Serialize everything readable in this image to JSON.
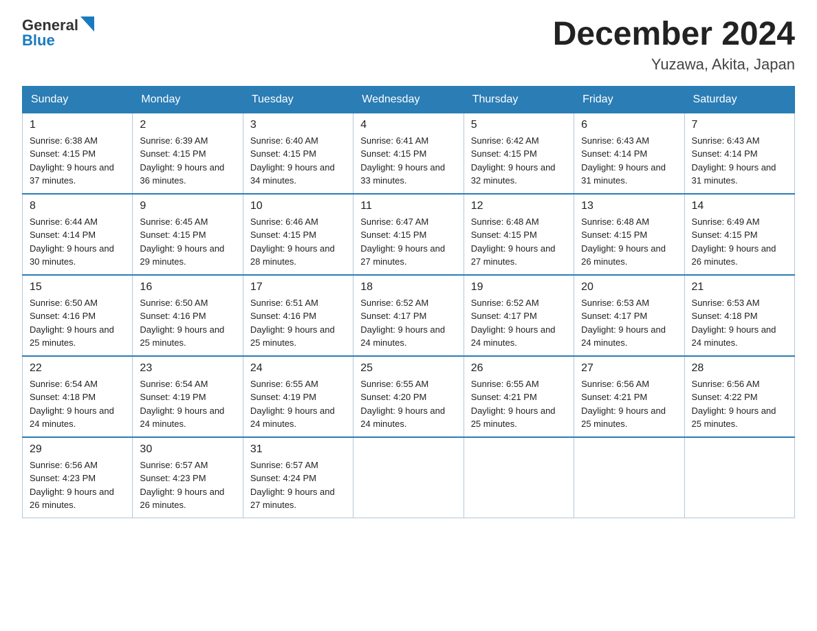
{
  "header": {
    "logo_general": "General",
    "logo_blue": "Blue",
    "month_title": "December 2024",
    "location": "Yuzawa, Akita, Japan"
  },
  "days_of_week": [
    "Sunday",
    "Monday",
    "Tuesday",
    "Wednesday",
    "Thursday",
    "Friday",
    "Saturday"
  ],
  "weeks": [
    [
      {
        "day": "1",
        "sunrise": "6:38 AM",
        "sunset": "4:15 PM",
        "daylight": "9 hours and 37 minutes."
      },
      {
        "day": "2",
        "sunrise": "6:39 AM",
        "sunset": "4:15 PM",
        "daylight": "9 hours and 36 minutes."
      },
      {
        "day": "3",
        "sunrise": "6:40 AM",
        "sunset": "4:15 PM",
        "daylight": "9 hours and 34 minutes."
      },
      {
        "day": "4",
        "sunrise": "6:41 AM",
        "sunset": "4:15 PM",
        "daylight": "9 hours and 33 minutes."
      },
      {
        "day": "5",
        "sunrise": "6:42 AM",
        "sunset": "4:15 PM",
        "daylight": "9 hours and 32 minutes."
      },
      {
        "day": "6",
        "sunrise": "6:43 AM",
        "sunset": "4:14 PM",
        "daylight": "9 hours and 31 minutes."
      },
      {
        "day": "7",
        "sunrise": "6:43 AM",
        "sunset": "4:14 PM",
        "daylight": "9 hours and 31 minutes."
      }
    ],
    [
      {
        "day": "8",
        "sunrise": "6:44 AM",
        "sunset": "4:14 PM",
        "daylight": "9 hours and 30 minutes."
      },
      {
        "day": "9",
        "sunrise": "6:45 AM",
        "sunset": "4:15 PM",
        "daylight": "9 hours and 29 minutes."
      },
      {
        "day": "10",
        "sunrise": "6:46 AM",
        "sunset": "4:15 PM",
        "daylight": "9 hours and 28 minutes."
      },
      {
        "day": "11",
        "sunrise": "6:47 AM",
        "sunset": "4:15 PM",
        "daylight": "9 hours and 27 minutes."
      },
      {
        "day": "12",
        "sunrise": "6:48 AM",
        "sunset": "4:15 PM",
        "daylight": "9 hours and 27 minutes."
      },
      {
        "day": "13",
        "sunrise": "6:48 AM",
        "sunset": "4:15 PM",
        "daylight": "9 hours and 26 minutes."
      },
      {
        "day": "14",
        "sunrise": "6:49 AM",
        "sunset": "4:15 PM",
        "daylight": "9 hours and 26 minutes."
      }
    ],
    [
      {
        "day": "15",
        "sunrise": "6:50 AM",
        "sunset": "4:16 PM",
        "daylight": "9 hours and 25 minutes."
      },
      {
        "day": "16",
        "sunrise": "6:50 AM",
        "sunset": "4:16 PM",
        "daylight": "9 hours and 25 minutes."
      },
      {
        "day": "17",
        "sunrise": "6:51 AM",
        "sunset": "4:16 PM",
        "daylight": "9 hours and 25 minutes."
      },
      {
        "day": "18",
        "sunrise": "6:52 AM",
        "sunset": "4:17 PM",
        "daylight": "9 hours and 24 minutes."
      },
      {
        "day": "19",
        "sunrise": "6:52 AM",
        "sunset": "4:17 PM",
        "daylight": "9 hours and 24 minutes."
      },
      {
        "day": "20",
        "sunrise": "6:53 AM",
        "sunset": "4:17 PM",
        "daylight": "9 hours and 24 minutes."
      },
      {
        "day": "21",
        "sunrise": "6:53 AM",
        "sunset": "4:18 PM",
        "daylight": "9 hours and 24 minutes."
      }
    ],
    [
      {
        "day": "22",
        "sunrise": "6:54 AM",
        "sunset": "4:18 PM",
        "daylight": "9 hours and 24 minutes."
      },
      {
        "day": "23",
        "sunrise": "6:54 AM",
        "sunset": "4:19 PM",
        "daylight": "9 hours and 24 minutes."
      },
      {
        "day": "24",
        "sunrise": "6:55 AM",
        "sunset": "4:19 PM",
        "daylight": "9 hours and 24 minutes."
      },
      {
        "day": "25",
        "sunrise": "6:55 AM",
        "sunset": "4:20 PM",
        "daylight": "9 hours and 24 minutes."
      },
      {
        "day": "26",
        "sunrise": "6:55 AM",
        "sunset": "4:21 PM",
        "daylight": "9 hours and 25 minutes."
      },
      {
        "day": "27",
        "sunrise": "6:56 AM",
        "sunset": "4:21 PM",
        "daylight": "9 hours and 25 minutes."
      },
      {
        "day": "28",
        "sunrise": "6:56 AM",
        "sunset": "4:22 PM",
        "daylight": "9 hours and 25 minutes."
      }
    ],
    [
      {
        "day": "29",
        "sunrise": "6:56 AM",
        "sunset": "4:23 PM",
        "daylight": "9 hours and 26 minutes."
      },
      {
        "day": "30",
        "sunrise": "6:57 AM",
        "sunset": "4:23 PM",
        "daylight": "9 hours and 26 minutes."
      },
      {
        "day": "31",
        "sunrise": "6:57 AM",
        "sunset": "4:24 PM",
        "daylight": "9 hours and 27 minutes."
      },
      null,
      null,
      null,
      null
    ]
  ]
}
